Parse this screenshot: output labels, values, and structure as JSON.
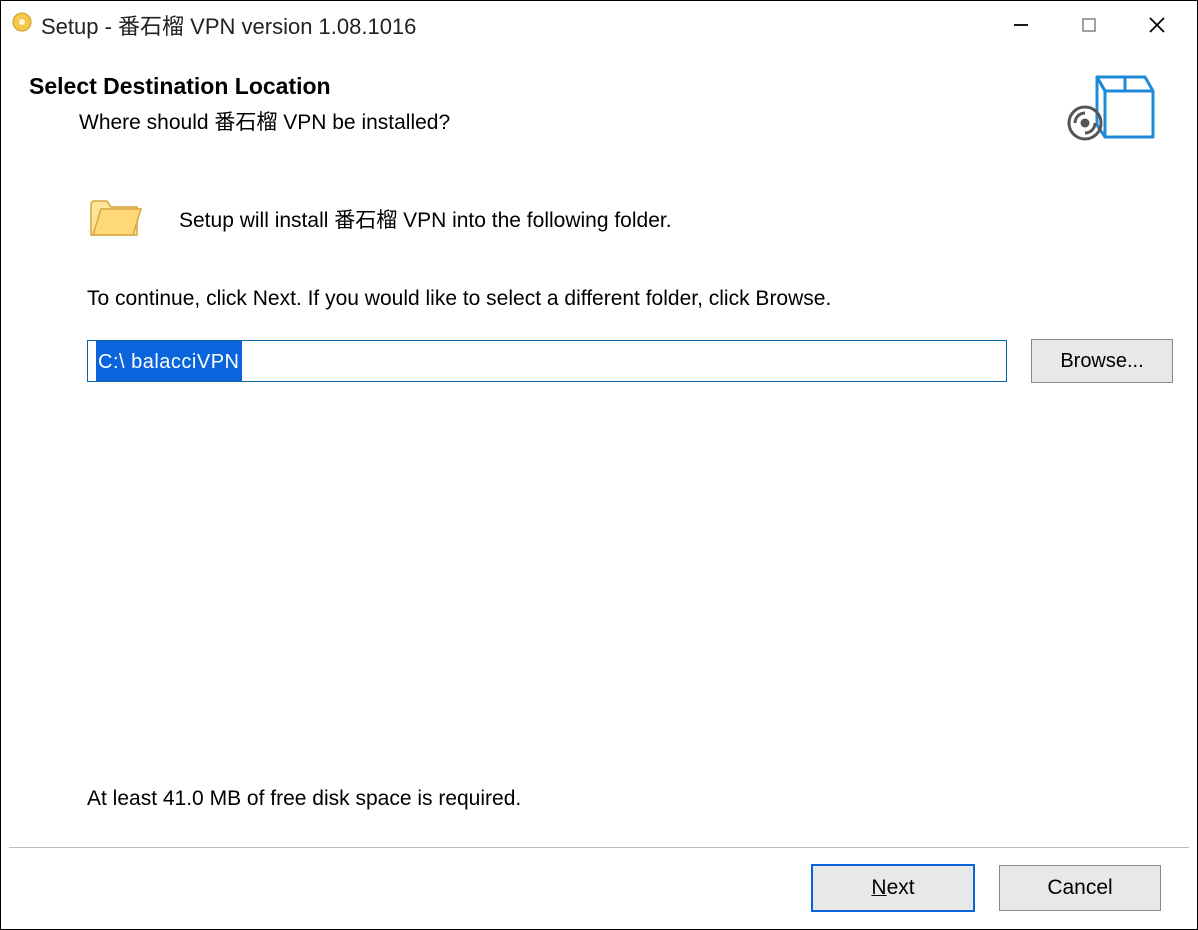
{
  "titlebar": {
    "title": "Setup - 番石榴 VPN version 1.08.1016"
  },
  "header": {
    "title": "Select Destination Location",
    "subtitle": "Where should 番石榴 VPN be installed?"
  },
  "body": {
    "folder_line": "Setup will install 番石榴 VPN into the following folder.",
    "instruction": "To continue, click Next. If you would like to select a different folder, click Browse.",
    "path_value": "C:\\ balacciVPN",
    "browse_label": "Browse...",
    "space_required": "At least 41.0 MB of free disk space is required."
  },
  "footer": {
    "next_label_underlined": "N",
    "next_label_rest": "ext",
    "cancel_label": "Cancel"
  }
}
